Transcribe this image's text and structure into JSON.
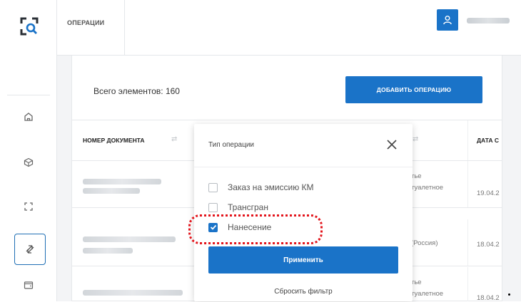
{
  "header": {
    "section_title": "ОПЕРАЦИИ"
  },
  "sidebar": {
    "items": [
      {
        "icon": "home-icon"
      },
      {
        "icon": "box-icon"
      },
      {
        "icon": "scan-icon"
      },
      {
        "icon": "operations-icon",
        "active": true
      },
      {
        "icon": "wallet-icon"
      }
    ]
  },
  "main": {
    "total_label": "Всего элементов: 160",
    "add_button": "ДОБАВИТЬ ОПЕРАЦИЮ",
    "table": {
      "columns": [
        "НОМЕР ДОКУМЕНТА",
        "ДАТА С"
      ],
      "rows": [
        {
          "type_text": "тье\nтуалетное",
          "date": "19.04.2"
        },
        {
          "type_text": "(Россия)",
          "date": "18.04.2"
        },
        {
          "type_text": "тье\nтуалетное",
          "date": "18.04.2"
        }
      ]
    }
  },
  "filter_popup": {
    "title": "Тип операции",
    "options": [
      {
        "label": "Заказ на эмиссию КМ",
        "checked": false
      },
      {
        "label": "Трансгран",
        "checked": false
      },
      {
        "label": "Нанесение",
        "checked": true
      }
    ],
    "apply_label": "Применить",
    "reset_label": "Сбросить фильтр"
  },
  "colors": {
    "accent": "#1a73c8",
    "highlight": "#e3141b"
  }
}
